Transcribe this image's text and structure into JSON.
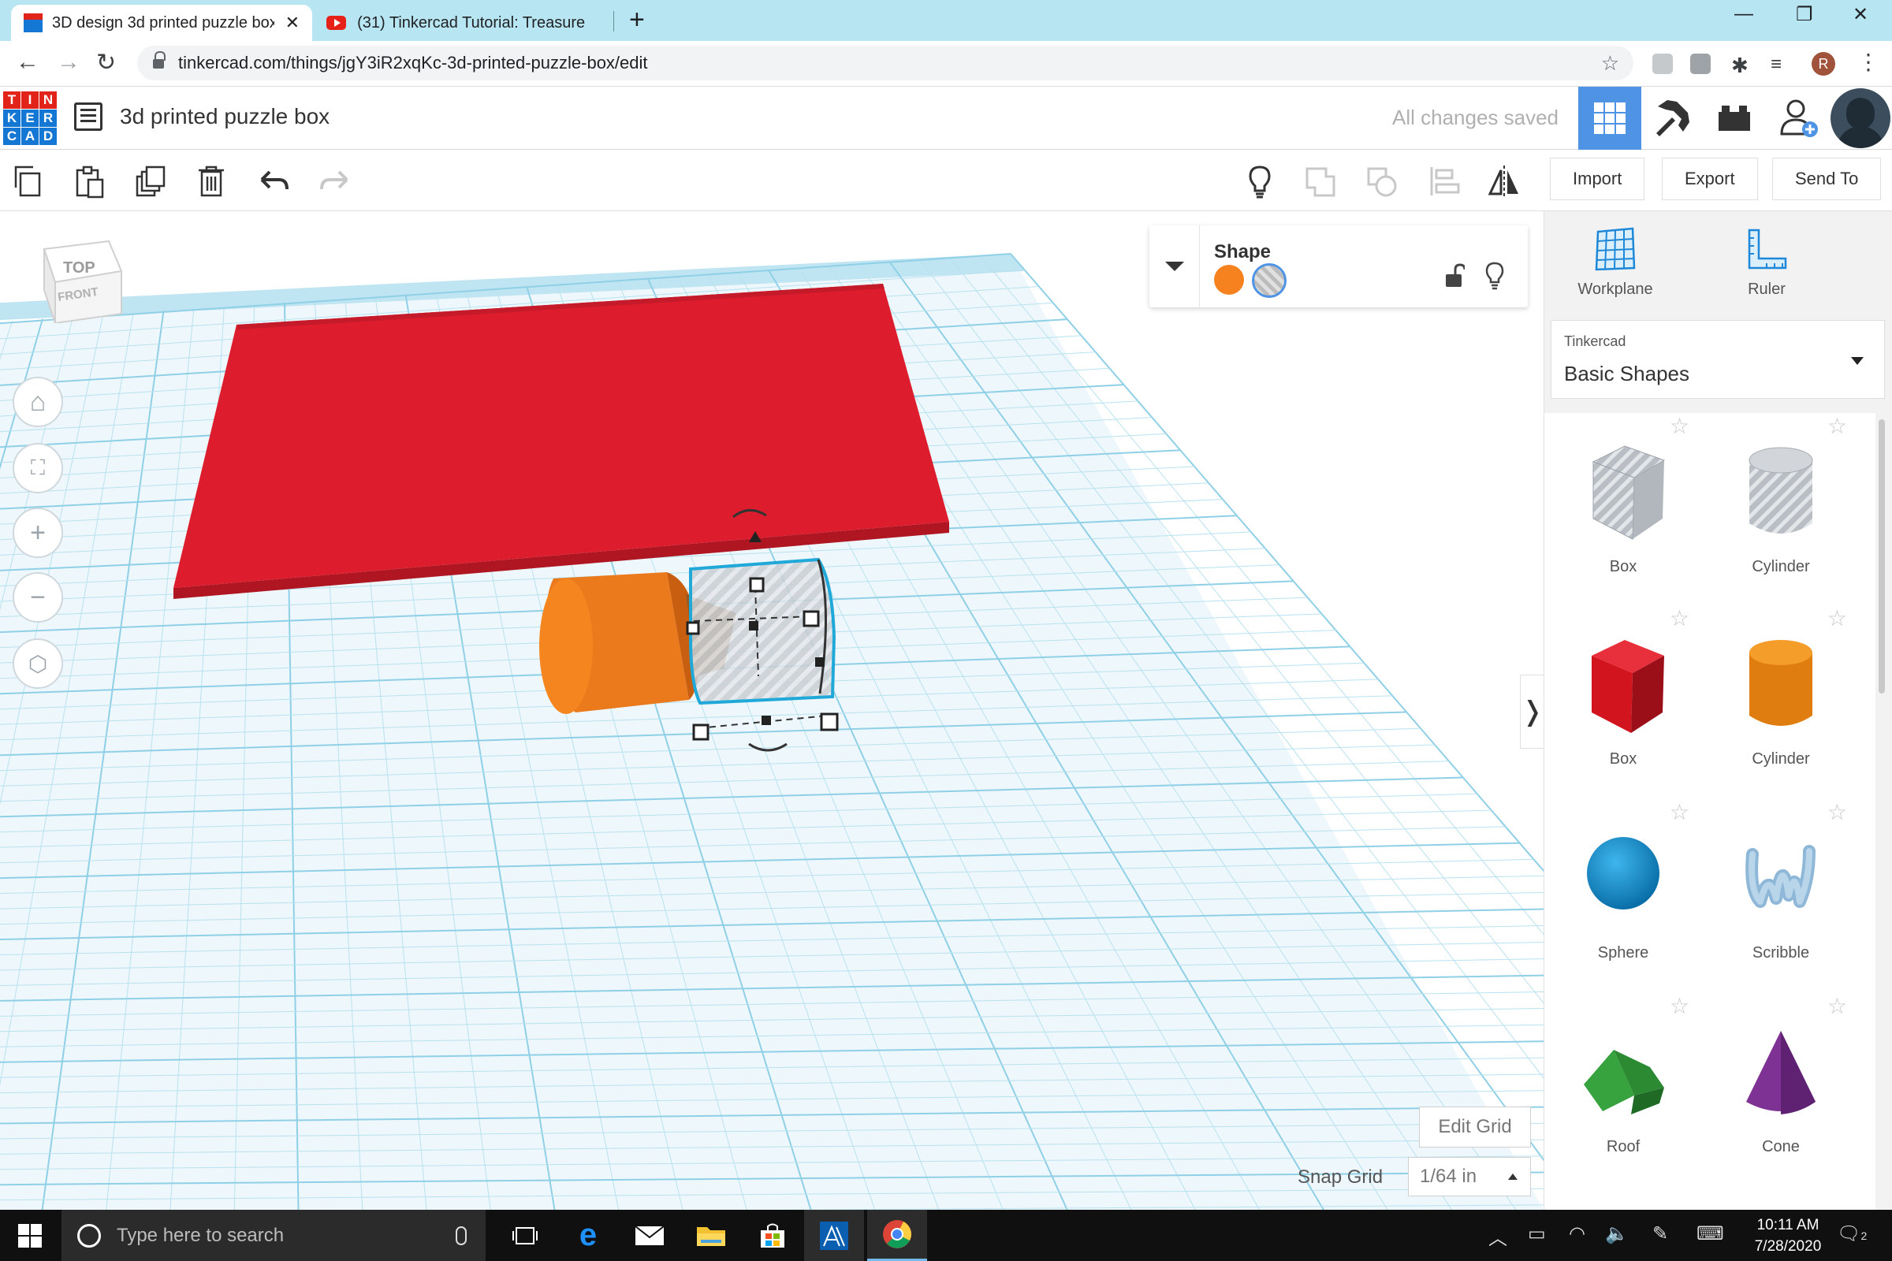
{
  "browser": {
    "tabs": [
      {
        "title": "3D design 3d printed puzzle box",
        "active": true
      },
      {
        "title": "(31) Tinkercad Tutorial: Treasure",
        "active": false
      }
    ],
    "url": "tinkercad.com/things/jgY3iR2xqKc-3d-printed-puzzle-box/edit",
    "profile_initial": "R"
  },
  "app": {
    "logo_letters": [
      "T",
      "I",
      "N",
      "K",
      "E",
      "R",
      "C",
      "A",
      "D"
    ],
    "logo_colors": [
      "#e2231a",
      "#e2231a",
      "#e2231a",
      "#1477d4",
      "#1477d4",
      "#1477d4",
      "#1477d4",
      "#1477d4",
      "#1477d4"
    ],
    "design_title": "3d printed puzzle box",
    "save_status": "All changes saved",
    "accent_color": "#4e93e4"
  },
  "toolbar": {
    "import_label": "Import",
    "export_label": "Export",
    "send_to_label": "Send To",
    "icons": [
      "copy-icon",
      "paste-icon",
      "duplicate-icon",
      "delete-icon",
      "undo-icon",
      "redo-icon",
      "note-lightbulb-icon",
      "group-icon",
      "ungroup-icon",
      "align-icon",
      "mirror-icon"
    ]
  },
  "viewport": {
    "viewcube_top": "TOP",
    "viewcube_front": "FRONT",
    "controls": [
      "home-view-icon",
      "fit-all-icon",
      "zoom-in-icon",
      "zoom-out-icon",
      "ortho-view-icon"
    ]
  },
  "inspector": {
    "title": "Shape",
    "solid_color": "#f5821f",
    "hole_selected": true
  },
  "grid": {
    "edit_grid_label": "Edit Grid",
    "snap_grid_label": "Snap Grid",
    "snap_grid_value": "1/64 in"
  },
  "panel": {
    "workplane_label": "Workplane",
    "ruler_label": "Ruler",
    "library_source": "Tinkercad",
    "library_name": "Basic Shapes",
    "shapes": [
      {
        "label": "Box",
        "kind": "box-hole"
      },
      {
        "label": "Cylinder",
        "kind": "cylinder-hole"
      },
      {
        "label": "Box",
        "kind": "box"
      },
      {
        "label": "Cylinder",
        "kind": "cylinder"
      },
      {
        "label": "Sphere",
        "kind": "sphere"
      },
      {
        "label": "Scribble",
        "kind": "scribble"
      },
      {
        "label": "Roof",
        "kind": "roof"
      },
      {
        "label": "Cone",
        "kind": "cone"
      }
    ]
  },
  "taskbar": {
    "search_placeholder": "Type here to search",
    "time": "10:11 AM",
    "date": "7/28/2020",
    "notifications": "2"
  }
}
